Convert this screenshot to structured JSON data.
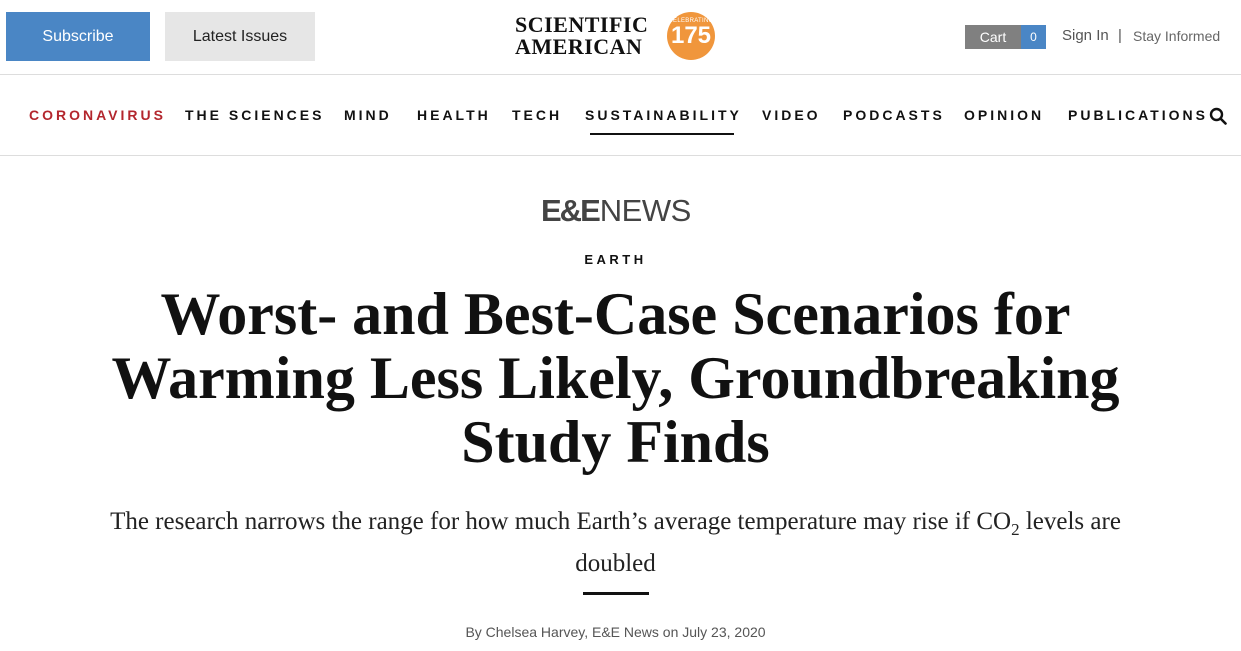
{
  "header": {
    "subscribe_label": "Subscribe",
    "latest_issues_label": "Latest Issues",
    "logo": {
      "line1": "SCIENTIFIC",
      "line2": "AMERICAN",
      "badge": "175",
      "badge_small": "CELEBRATING"
    },
    "cart_label": "Cart",
    "cart_count": "0",
    "sign_in_label": "Sign In",
    "separator": "|",
    "stay_informed_label": "Stay Informed"
  },
  "nav": {
    "items": [
      {
        "label": "CORONAVIRUS"
      },
      {
        "label": "THE SCIENCES"
      },
      {
        "label": "MIND"
      },
      {
        "label": "HEALTH"
      },
      {
        "label": "TECH"
      },
      {
        "label": "SUSTAINABILITY"
      },
      {
        "label": "VIDEO"
      },
      {
        "label": "PODCASTS"
      },
      {
        "label": "OPINION"
      },
      {
        "label": "PUBLICATIONS"
      }
    ],
    "search_icon": "search-icon"
  },
  "article": {
    "brand_ee": "E&E",
    "brand_news": "NEWS",
    "section": "EARTH",
    "headline": "Worst- and Best-Case Scenarios for Warming Less Likely, Groundbreaking Study Finds",
    "dek_before": "The research narrows the range for how much Earth’s average temperature may rise if CO",
    "dek_sub": "2",
    "dek_after": " levels are doubled",
    "byline": "By Chelsea Harvey, E&E News on July 23, 2020"
  },
  "colors": {
    "subscribe_bg": "#4a86c5",
    "coronavirus_red": "#b3262d",
    "badge_orange": "#f0963c",
    "cart_gray": "#808080"
  }
}
